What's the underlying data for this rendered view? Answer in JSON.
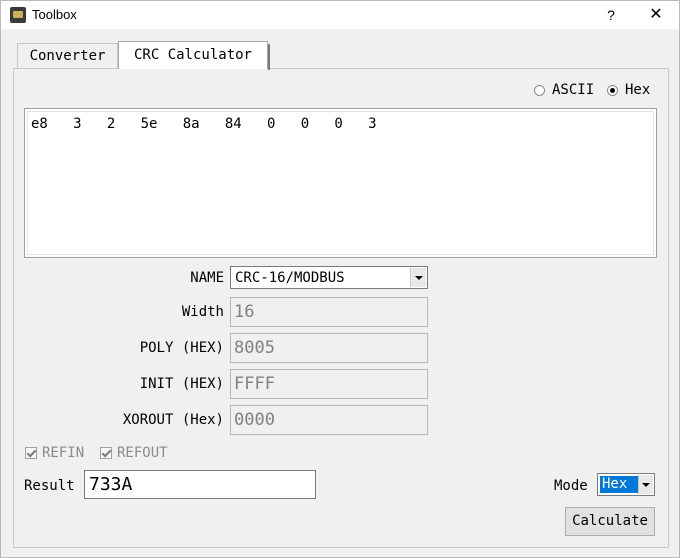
{
  "window": {
    "title": "Toolbox",
    "help_label": "?",
    "close_label": "✕"
  },
  "tabs": [
    {
      "label": "Converter",
      "active": false
    },
    {
      "label": "CRC Calculator",
      "active": true
    }
  ],
  "format": {
    "options": [
      "ASCII",
      "Hex"
    ],
    "selected": "Hex"
  },
  "input": {
    "value": "e8   3   2   5e   8a   84   0   0   0   3"
  },
  "params": {
    "name_label": "NAME",
    "name_value": "CRC-16/MODBUS",
    "width_label": "Width",
    "width_value": "16",
    "poly_label": "POLY (HEX)",
    "poly_value": "8005",
    "init_label": "INIT (HEX)",
    "init_value": "FFFF",
    "xorout_label": "XOROUT (Hex)",
    "xorout_value": "0000"
  },
  "checkboxes": {
    "refin_label": "REFIN",
    "refin_checked": true,
    "refout_label": "REFOUT",
    "refout_checked": true
  },
  "result": {
    "label": "Result",
    "value": "733A"
  },
  "mode": {
    "label": "Mode",
    "value": "Hex"
  },
  "actions": {
    "calculate_label": "Calculate"
  },
  "colors": {
    "selection": "#0078d7",
    "background": "#f0f0f0"
  }
}
